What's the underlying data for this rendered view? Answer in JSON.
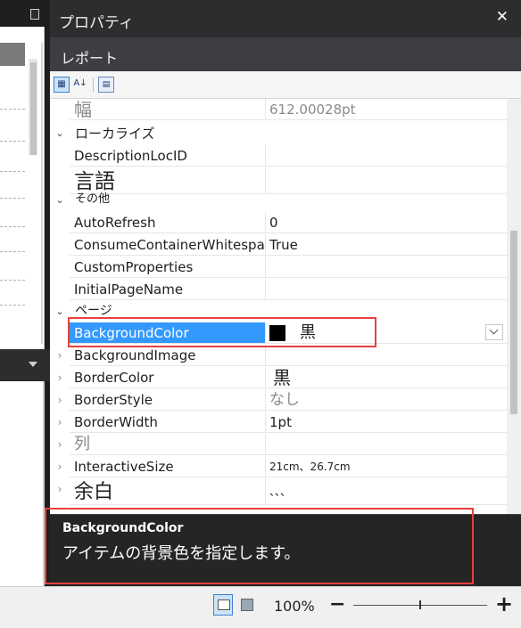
{
  "panel": {
    "title": "プロパティ",
    "close": "✕",
    "subtitle": "レポート"
  },
  "toolbar": {
    "categorized_icon": "▦",
    "alphabetical_label": "A↓",
    "pages_icon": "▤"
  },
  "rows": {
    "width": {
      "name": "幅",
      "value": "612.00028pt"
    },
    "localize_category": {
      "gut": "⌄",
      "name": "ローカライズ"
    },
    "description_loc_id": {
      "name": "DescriptionLocID",
      "value": ""
    },
    "language": {
      "name": "言語",
      "value": ""
    },
    "other_category": {
      "gut": "⌄",
      "name": "その他"
    },
    "auto_refresh": {
      "name": "AutoRefresh",
      "value": "0"
    },
    "consume_container": {
      "name": "ConsumeContainerWhitespa",
      "value": "True"
    },
    "custom_properties": {
      "name": "CustomProperties",
      "value": ""
    },
    "initial_page_name": {
      "name": "InitialPageName",
      "value": ""
    },
    "page_category": {
      "gut": "⌄",
      "name": "ページ"
    },
    "background_color": {
      "name": "BackgroundColor",
      "value": "黒",
      "swatch_color": "#000000"
    },
    "background_image": {
      "gut": "›",
      "name": "BackgroundImage",
      "value": ""
    },
    "border_color": {
      "gut": "›",
      "name": "BorderColor",
      "value": "黒"
    },
    "border_style": {
      "gut": "›",
      "name": "BorderStyle",
      "value": "なし"
    },
    "border_width": {
      "gut": "›",
      "name": "BorderWidth",
      "value": "1pt"
    },
    "columns": {
      "gut": "›",
      "name": "列",
      "value": ""
    },
    "interactive_size": {
      "gut": "›",
      "name": "InteractiveSize",
      "value": "21cm、26.7cm"
    },
    "margins": {
      "gut": "›",
      "name": "余白",
      "value": "、、、"
    }
  },
  "description": {
    "title": "BackgroundColor",
    "text": "アイテムの背景色を指定します。"
  },
  "statusbar": {
    "zoom": "100%",
    "zoom_out": "−",
    "zoom_in": "+"
  },
  "colors": {
    "accent_selected": "#3399ff",
    "highlight_border": "#e8413c",
    "panel_bg": "#2d2d30"
  }
}
